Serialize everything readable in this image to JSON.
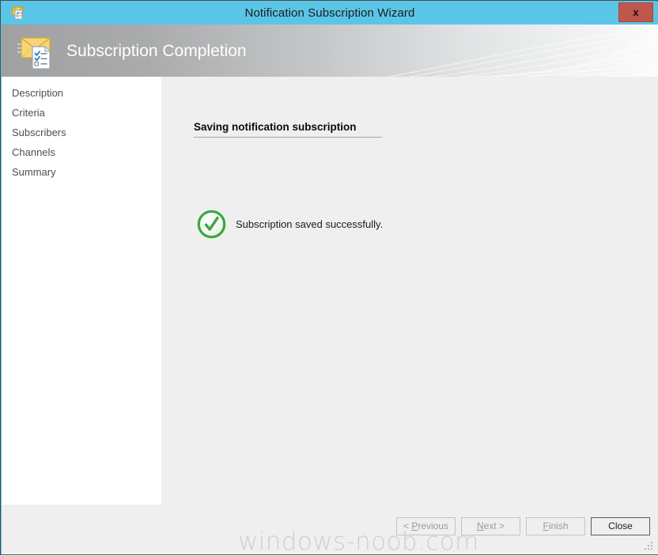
{
  "window": {
    "title": "Notification Subscription Wizard",
    "title_icon": "envelope-checklist-icon",
    "close_label": "x",
    "frame_color": "#5bc5e8",
    "close_button_color": "#c0564c"
  },
  "header": {
    "title": "Subscription Completion",
    "icon": "envelope-checklist-icon"
  },
  "sidebar": {
    "items": [
      {
        "label": "Description"
      },
      {
        "label": "Criteria"
      },
      {
        "label": "Subscribers"
      },
      {
        "label": "Channels"
      },
      {
        "label": "Summary"
      }
    ]
  },
  "main": {
    "heading": "Saving notification subscription",
    "status_icon": "green-check-circle-icon",
    "status_message": "Subscription saved successfully.",
    "status_color": "#35a535"
  },
  "footer": {
    "buttons": [
      {
        "label": "< Previous",
        "mnemonic": "P",
        "enabled": false
      },
      {
        "label": "Next >",
        "mnemonic": "N",
        "enabled": false
      },
      {
        "label": "Finish",
        "mnemonic": "F",
        "enabled": false
      },
      {
        "label": "Close",
        "mnemonic": "",
        "enabled": true
      }
    ]
  },
  "watermark": {
    "text": "windows-noob.com"
  }
}
